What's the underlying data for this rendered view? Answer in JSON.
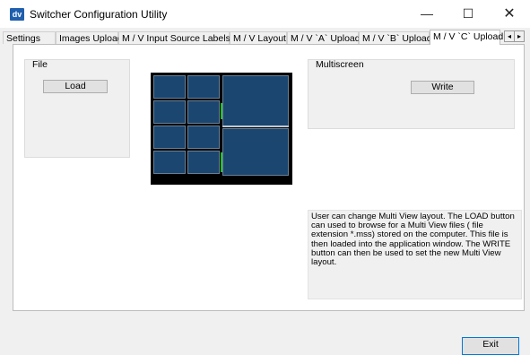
{
  "window": {
    "title": "Switcher Configuration Utility",
    "logo_text": "dv",
    "minimize_glyph": "—",
    "maximize_glyph": "☐",
    "close_glyph": "✕"
  },
  "tabs": [
    {
      "label": "Settings"
    },
    {
      "label": "Images Upload"
    },
    {
      "label": "M / V  Input Source Labels"
    },
    {
      "label": "M / V Layout"
    },
    {
      "label": "M / V `A` Upload"
    },
    {
      "label": "M / V `B` Upload"
    },
    {
      "label": "M / V `C` Upload",
      "active": true
    }
  ],
  "tab_scroll": {
    "left_glyph": "◂",
    "right_glyph": "▸"
  },
  "file_group": {
    "legend": "File",
    "load_label": "Load"
  },
  "multiscreen_group": {
    "legend": "Multiscreen",
    "write_label": "Write"
  },
  "description": "User can change Multi View  layout. The LOAD button can used to browse for a Multi View  files ( file extension *.mss) stored on the computer. This file is then loaded into the application window. The WRITE button can then be used to set the new Multi View  layout.",
  "footer": {
    "exit_label": "Exit"
  },
  "colors": {
    "tile": "#1a4670",
    "preview_background": "#000000",
    "active_indicator": "#22c12e"
  }
}
